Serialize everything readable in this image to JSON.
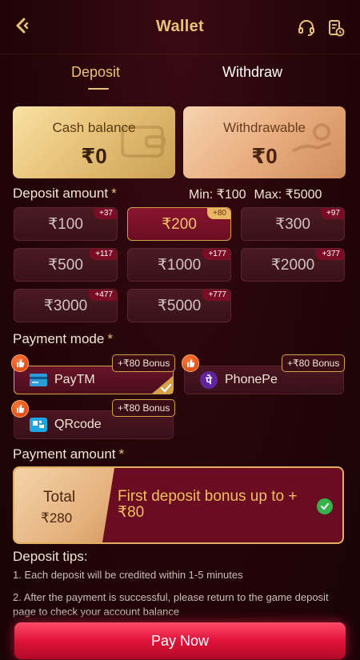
{
  "header": {
    "title": "Wallet",
    "back_icon": "back-arrow-icon",
    "support_icon": "headset-icon",
    "record_icon": "history-record-icon"
  },
  "tabs": [
    {
      "label": "Deposit",
      "active": true
    },
    {
      "label": "Withdraw",
      "active": false
    }
  ],
  "balances": {
    "cash": {
      "label": "Cash balance",
      "value": "₹0"
    },
    "withdrawable": {
      "label": "Withdrawable",
      "value": "₹0"
    }
  },
  "deposit": {
    "title": "Deposit amount",
    "required_mark": "*",
    "min": "Min: ₹100",
    "max": "Max: ₹5000",
    "amounts": [
      {
        "label": "₹100",
        "bonus": "+37",
        "selected": false
      },
      {
        "label": "₹200",
        "bonus": "+80",
        "selected": true
      },
      {
        "label": "₹300",
        "bonus": "+97",
        "selected": false
      },
      {
        "label": "₹500",
        "bonus": "+117",
        "selected": false
      },
      {
        "label": "₹1000",
        "bonus": "+177",
        "selected": false
      },
      {
        "label": "₹2000",
        "bonus": "+377",
        "selected": false
      },
      {
        "label": "₹3000",
        "bonus": "+477",
        "selected": false
      },
      {
        "label": "₹5000",
        "bonus": "+777",
        "selected": false
      }
    ]
  },
  "payment_mode": {
    "title": "Payment mode",
    "required_mark": "*",
    "methods": [
      {
        "name": "PayTM",
        "bonus": "+₹80 Bonus",
        "selected": true,
        "icon": "paytm-card-icon"
      },
      {
        "name": "PhonePe",
        "bonus": "+₹80 Bonus",
        "selected": false,
        "icon": "phonepe-icon"
      },
      {
        "name": "QRcode",
        "bonus": "+₹80 Bonus",
        "selected": false,
        "icon": "qrcode-icon"
      }
    ]
  },
  "payment_amount": {
    "title": "Payment amount",
    "required_mark": "*",
    "total_label": "Total",
    "total_value": "₹280",
    "bonus_text": "First deposit bonus up to +₹80"
  },
  "tips": {
    "title": "Deposit tips:",
    "items": [
      "1. Each deposit will be credited within 1-5 minutes",
      "2. After the payment is successful, please return to the game deposit page to check your account balance"
    ]
  },
  "pay_button": {
    "label": "Pay Now"
  },
  "colors": {
    "accent_gold": "#e9c27a",
    "pay_button": "#e0123a",
    "background": "#240508"
  }
}
